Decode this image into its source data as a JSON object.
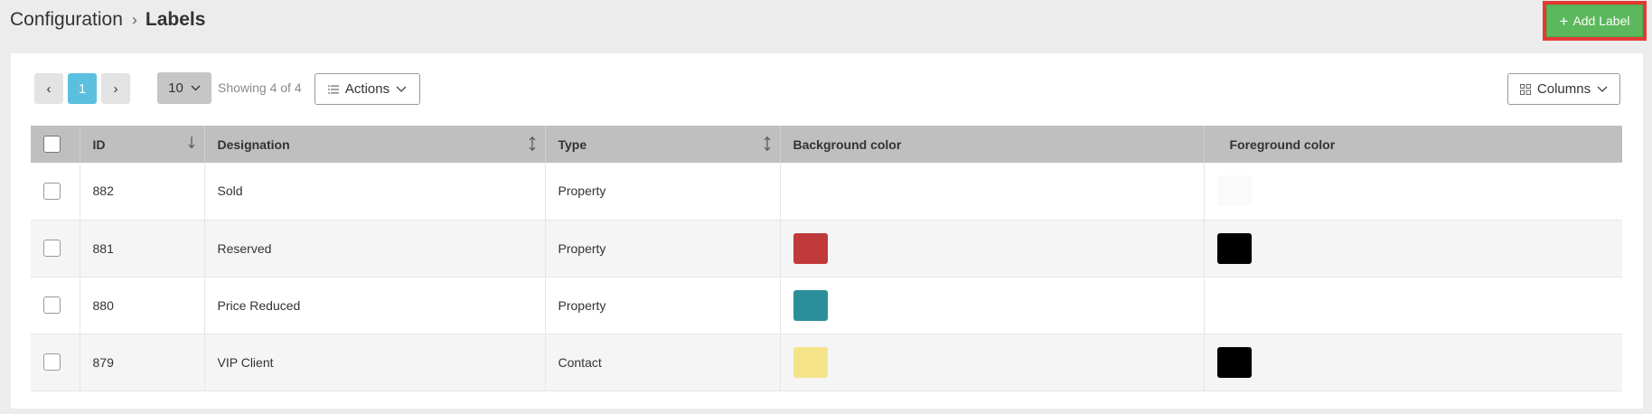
{
  "breadcrumb": {
    "parent": "Configuration",
    "separator": "›",
    "current": "Labels"
  },
  "add_button": {
    "icon": "+",
    "label": "Add Label"
  },
  "pager": {
    "prev": "‹",
    "current_page": "1",
    "next": "›"
  },
  "per_page": {
    "value": "10"
  },
  "showing_text": "Showing 4 of 4",
  "actions_button": {
    "label": "Actions"
  },
  "columns_button": {
    "label": "Columns"
  },
  "table": {
    "headers": {
      "id": "ID",
      "designation": "Designation",
      "type": "Type",
      "background": "Background color",
      "foreground": "Foreground color"
    },
    "rows": [
      {
        "id": "882",
        "designation": "Sold",
        "type": "Property",
        "background": "",
        "foreground": "#fafafa"
      },
      {
        "id": "881",
        "designation": "Reserved",
        "type": "Property",
        "background": "#c0393b",
        "foreground": "#000000"
      },
      {
        "id": "880",
        "designation": "Price Reduced",
        "type": "Property",
        "background": "#2a8f99",
        "foreground": ""
      },
      {
        "id": "879",
        "designation": "VIP Client",
        "type": "Contact",
        "background": "#f5e38a",
        "foreground": "#000000"
      }
    ]
  },
  "colors": {
    "accent_green": "#5cb85c",
    "active_page": "#5bc0de",
    "highlight_border": "#e53935",
    "header_bg": "#bfbfbf"
  }
}
